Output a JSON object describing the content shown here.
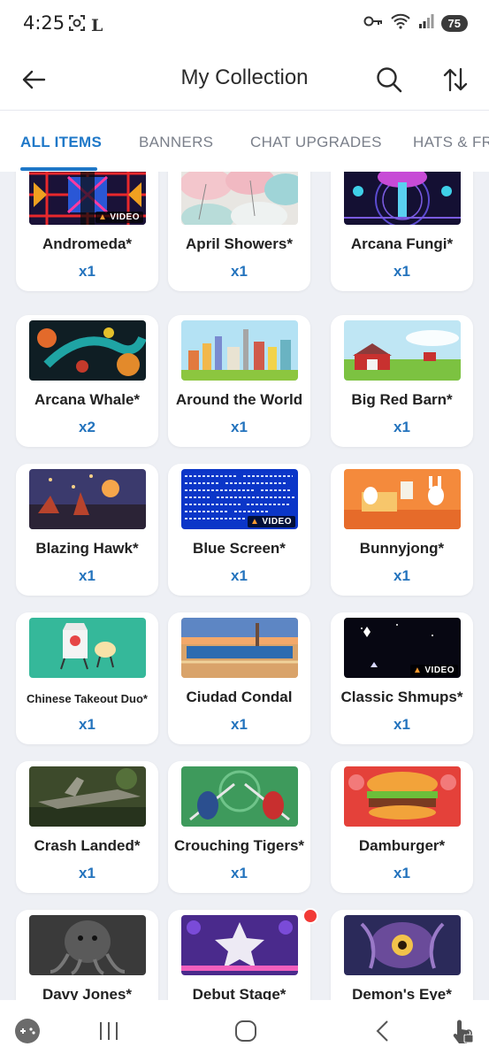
{
  "status_bar": {
    "time": "4:25",
    "battery": "75",
    "left_icons": [
      "screenshot-icon",
      "l-app-icon"
    ],
    "right_icons": [
      "key-icon",
      "wifi-icon",
      "signal-icon"
    ]
  },
  "header": {
    "title": "My Collection",
    "back_icon": "arrow-left-icon",
    "search_icon": "search-icon",
    "sort_icon": "sort-icon"
  },
  "tabs": [
    {
      "label": "ALL ITEMS",
      "active": true
    },
    {
      "label": "BANNERS",
      "active": false
    },
    {
      "label": "CHAT UPGRADES",
      "active": false
    },
    {
      "label": "HATS & FRAMES",
      "active": false
    }
  ],
  "colors": {
    "accent": "#1f78c8",
    "quantity": "#2373bd",
    "background": "#eef0f5",
    "new_dot": "#f23a36"
  },
  "items": [
    {
      "name": "Andromeda*",
      "qty": "x1",
      "video": true
    },
    {
      "name": "April Showers*",
      "qty": "x1",
      "video": false
    },
    {
      "name": "Arcana Fungi*",
      "qty": "x1",
      "video": false
    },
    {
      "name": "Arcana Whale*",
      "qty": "x2",
      "video": false
    },
    {
      "name": "Around the World",
      "qty": "x1",
      "video": false
    },
    {
      "name": "Big Red Barn*",
      "qty": "x1",
      "video": false
    },
    {
      "name": "Blazing Hawk*",
      "qty": "x1",
      "video": false
    },
    {
      "name": "Blue Screen*",
      "qty": "x1",
      "video": true
    },
    {
      "name": "Bunnyjong*",
      "qty": "x1",
      "video": false
    },
    {
      "name": "Chinese Takeout Duo*",
      "qty": "x1",
      "video": false
    },
    {
      "name": "Ciudad Condal",
      "qty": "x1",
      "video": false
    },
    {
      "name": "Classic Shmups*",
      "qty": "x1",
      "video": true
    },
    {
      "name": "Crash Landed*",
      "qty": "x1",
      "video": false
    },
    {
      "name": "Crouching Tigers*",
      "qty": "x1",
      "video": false
    },
    {
      "name": "Damburger*",
      "qty": "x1",
      "video": false
    },
    {
      "name": "Davy Jones*",
      "qty": "",
      "video": false
    },
    {
      "name": "Debut Stage*",
      "qty": "",
      "video": false,
      "new": true
    },
    {
      "name": "Demon's Eye*",
      "qty": "",
      "video": false
    }
  ],
  "video_label": "VIDEO",
  "nav_bar": {
    "icons": [
      "game-controller-icon",
      "recent-apps-icon",
      "home-icon",
      "back-icon",
      "touch-lock-icon"
    ]
  }
}
